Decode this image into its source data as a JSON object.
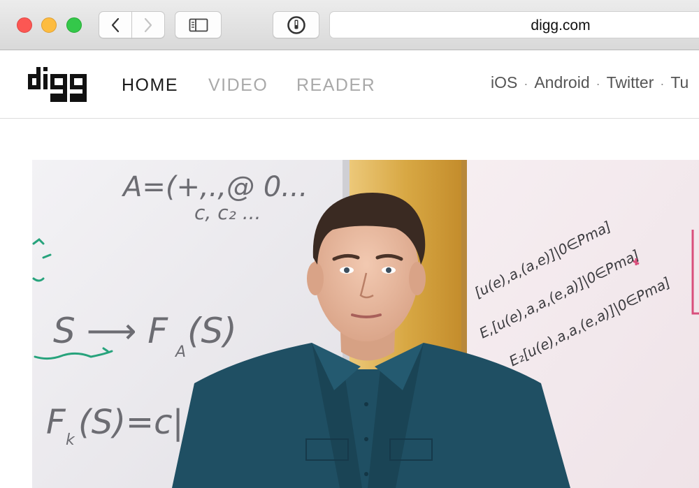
{
  "browser": {
    "url": "digg.com",
    "traffic_lights": {
      "close": "#fc5753",
      "minimize": "#fdbc40",
      "zoom": "#34c84a"
    },
    "icons": [
      "chevron-left-icon",
      "chevron-right-icon",
      "sidebar-icon",
      "password-manager-icon"
    ]
  },
  "site": {
    "logo_text": "digg",
    "nav": [
      {
        "label": "HOME",
        "active": true
      },
      {
        "label": "VIDEO",
        "active": false
      },
      {
        "label": "READER",
        "active": false
      }
    ],
    "social": {
      "ios": "iOS",
      "android": "Android",
      "twitter": "Twitter",
      "tumblr": "Tu",
      "separator": "·"
    }
  },
  "hero": {
    "whiteboard_left": {
      "line1": "A=(+,.,@ 0...",
      "line2": "c, c₂ ...",
      "line3": "S ⟶ F",
      "line3_sub": "A",
      "line3_end": "(S)",
      "line4": "F",
      "line4_sub": "k",
      "line4_end": "(S)=c|(S"
    },
    "whiteboard_right": {
      "line1": "[u(e),a,(a,e)]|0∈Pma]",
      "line2": "E,[u(e),a,a,(e,a)]|0∈Pma]",
      "line3": "E₂[u(e),a,a,(e,a)]|0∈Pma]"
    }
  },
  "colors": {
    "nav_active": "#1a1a1a",
    "nav_inactive": "#a9a9a9",
    "shirt": "#1f4f63",
    "wall": "#d7a947"
  }
}
